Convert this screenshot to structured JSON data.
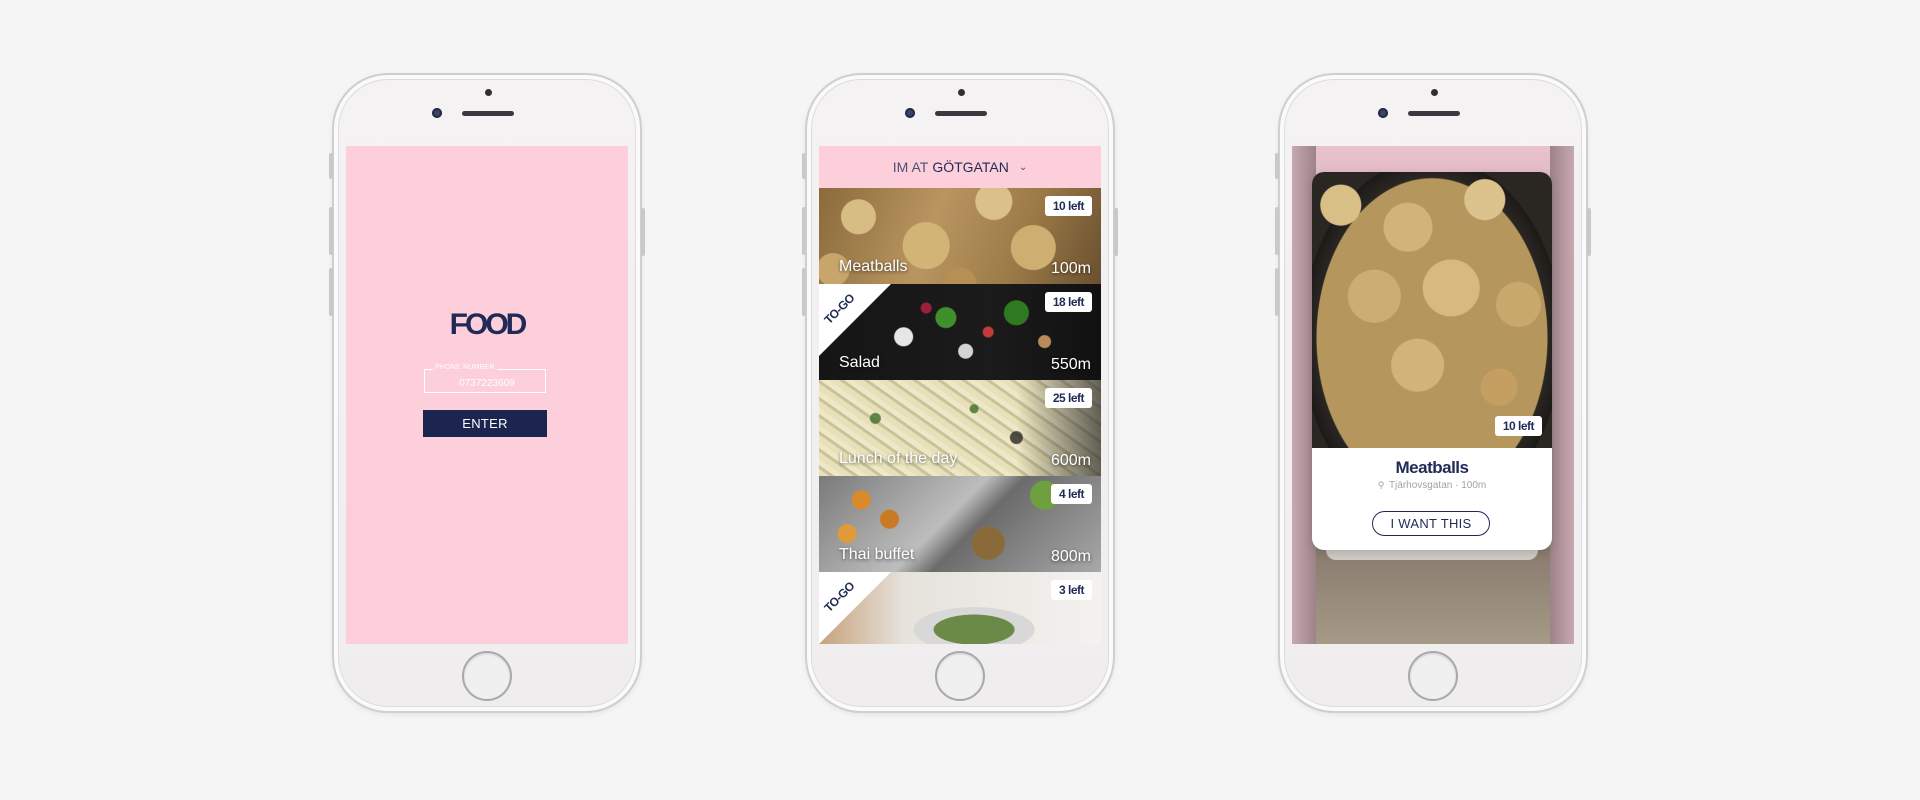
{
  "screen1": {
    "logo": "FOOD",
    "phone_field": {
      "label": "PHONE NUMBER",
      "value": "0737223609"
    },
    "enter_label": "ENTER"
  },
  "screen2": {
    "location_prefix": "IM AT",
    "location_name": "GÖTGATAN",
    "cards": [
      {
        "name": "Meatballs",
        "distance": "100m",
        "left": "10 left",
        "togo": false
      },
      {
        "name": "Salad",
        "distance": "550m",
        "left": "18 left",
        "togo": true,
        "togo_label": "TO-GO"
      },
      {
        "name": "Lunch of the day",
        "distance": "600m",
        "left": "25 left",
        "togo": false
      },
      {
        "name": "Thai buffet",
        "distance": "800m",
        "left": "4 left",
        "togo": false
      },
      {
        "name": "",
        "distance": "",
        "left": "3 left",
        "togo": true,
        "togo_label": "TO-GO"
      }
    ]
  },
  "screen3": {
    "left": "10 left",
    "title": "Meatballs",
    "subtitle": "Tjärhovsgatan · 100m",
    "cta": "I WANT THIS"
  },
  "colors": {
    "pink": "#fdcfda",
    "navy": "#1f2a56",
    "button": "#1b2550"
  },
  "icons": [
    "camera-icon",
    "chevron-down-icon",
    "location-pin-icon",
    "home-button-icon"
  ]
}
